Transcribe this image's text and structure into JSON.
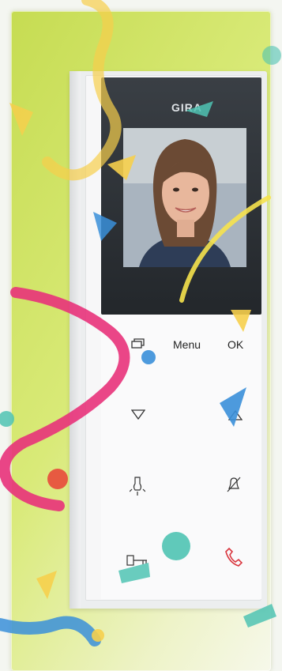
{
  "device": {
    "brand": "GIRA",
    "buttons": {
      "menu_label": "Menu",
      "ok_label": "OK"
    },
    "icons": [
      "camera-switch-icon",
      "arrow-down-icon",
      "arrow-up-icon",
      "light-icon",
      "mute-bell-icon",
      "door-key-icon",
      "phone-hangup-icon"
    ]
  },
  "colors": {
    "glass_frame": "#cfe25f",
    "screen_bezel": "#2d3238",
    "hangup_red": "#d9363e",
    "confetti_pink": "#e8327a",
    "confetti_yellow": "#f6cf4c",
    "confetti_teal": "#4fc3b3",
    "confetti_blue": "#3a8fd9"
  }
}
